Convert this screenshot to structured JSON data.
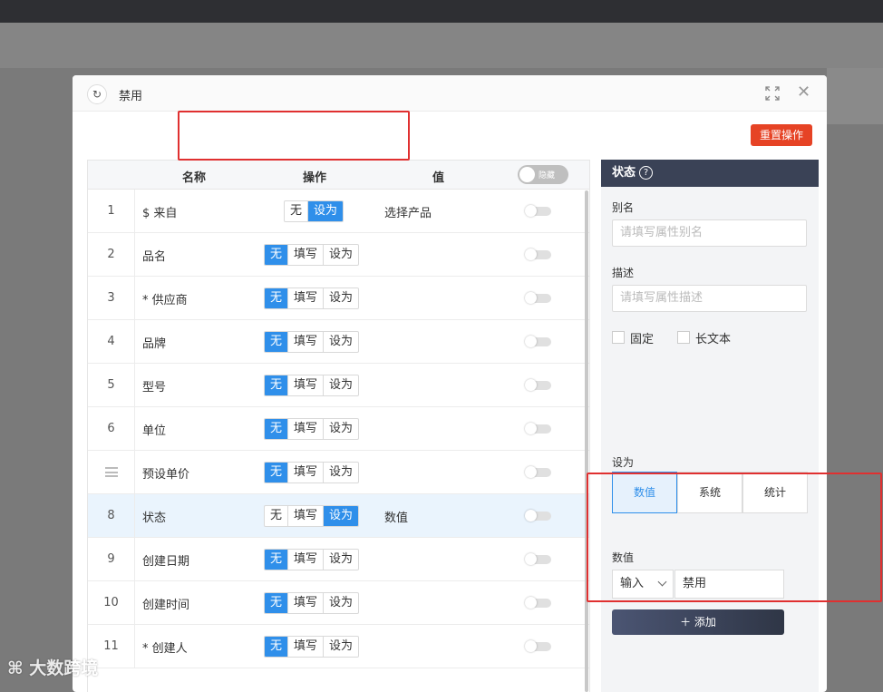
{
  "modal": {
    "title": "禁用",
    "reset_label": "重置操作"
  },
  "table": {
    "headers": {
      "name": "名称",
      "op": "操作",
      "value": "值",
      "toggle": "隐藏"
    },
    "rows": [
      {
        "idx": "1",
        "name": "$ 来自",
        "ops": [
          "无",
          "设为"
        ],
        "active": 1,
        "value": "选择产品"
      },
      {
        "idx": "2",
        "name": "品名",
        "ops": [
          "无",
          "填写",
          "设为"
        ],
        "active": 0,
        "value": ""
      },
      {
        "idx": "3",
        "name": "* 供应商",
        "ops": [
          "无",
          "填写",
          "设为"
        ],
        "active": 0,
        "value": ""
      },
      {
        "idx": "4",
        "name": "品牌",
        "ops": [
          "无",
          "填写",
          "设为"
        ],
        "active": 0,
        "value": ""
      },
      {
        "idx": "5",
        "name": "型号",
        "ops": [
          "无",
          "填写",
          "设为"
        ],
        "active": 0,
        "value": ""
      },
      {
        "idx": "6",
        "name": "单位",
        "ops": [
          "无",
          "填写",
          "设为"
        ],
        "active": 0,
        "value": ""
      },
      {
        "idx": "",
        "name": "预设单价",
        "ops": [
          "无",
          "填写",
          "设为"
        ],
        "active": 0,
        "value": ""
      },
      {
        "idx": "8",
        "name": "状态",
        "ops": [
          "无",
          "填写",
          "设为"
        ],
        "active": 2,
        "value": "数值"
      },
      {
        "idx": "9",
        "name": "创建日期",
        "ops": [
          "无",
          "填写",
          "设为"
        ],
        "active": 0,
        "value": ""
      },
      {
        "idx": "10",
        "name": "创建时间",
        "ops": [
          "无",
          "填写",
          "设为"
        ],
        "active": 0,
        "value": ""
      },
      {
        "idx": "11",
        "name": "* 创建人",
        "ops": [
          "无",
          "填写",
          "设为"
        ],
        "active": 0,
        "value": ""
      }
    ]
  },
  "panel": {
    "title": "状态",
    "alias_label": "别名",
    "alias_placeholder": "请填写属性别名",
    "desc_label": "描述",
    "desc_placeholder": "请填写属性描述",
    "fixed_label": "固定",
    "longtext_label": "长文本",
    "setas_label": "设为",
    "setas_options": [
      "数值",
      "系统",
      "统计"
    ],
    "setas_active": 0,
    "value_label": "数值",
    "input_mode": "输入",
    "value": "禁用",
    "add_label": "添加"
  },
  "watermark": "大数跨境",
  "colors": {
    "primary": "#2f8fea",
    "danger": "#e64325",
    "panel_header": "#3a4256"
  }
}
